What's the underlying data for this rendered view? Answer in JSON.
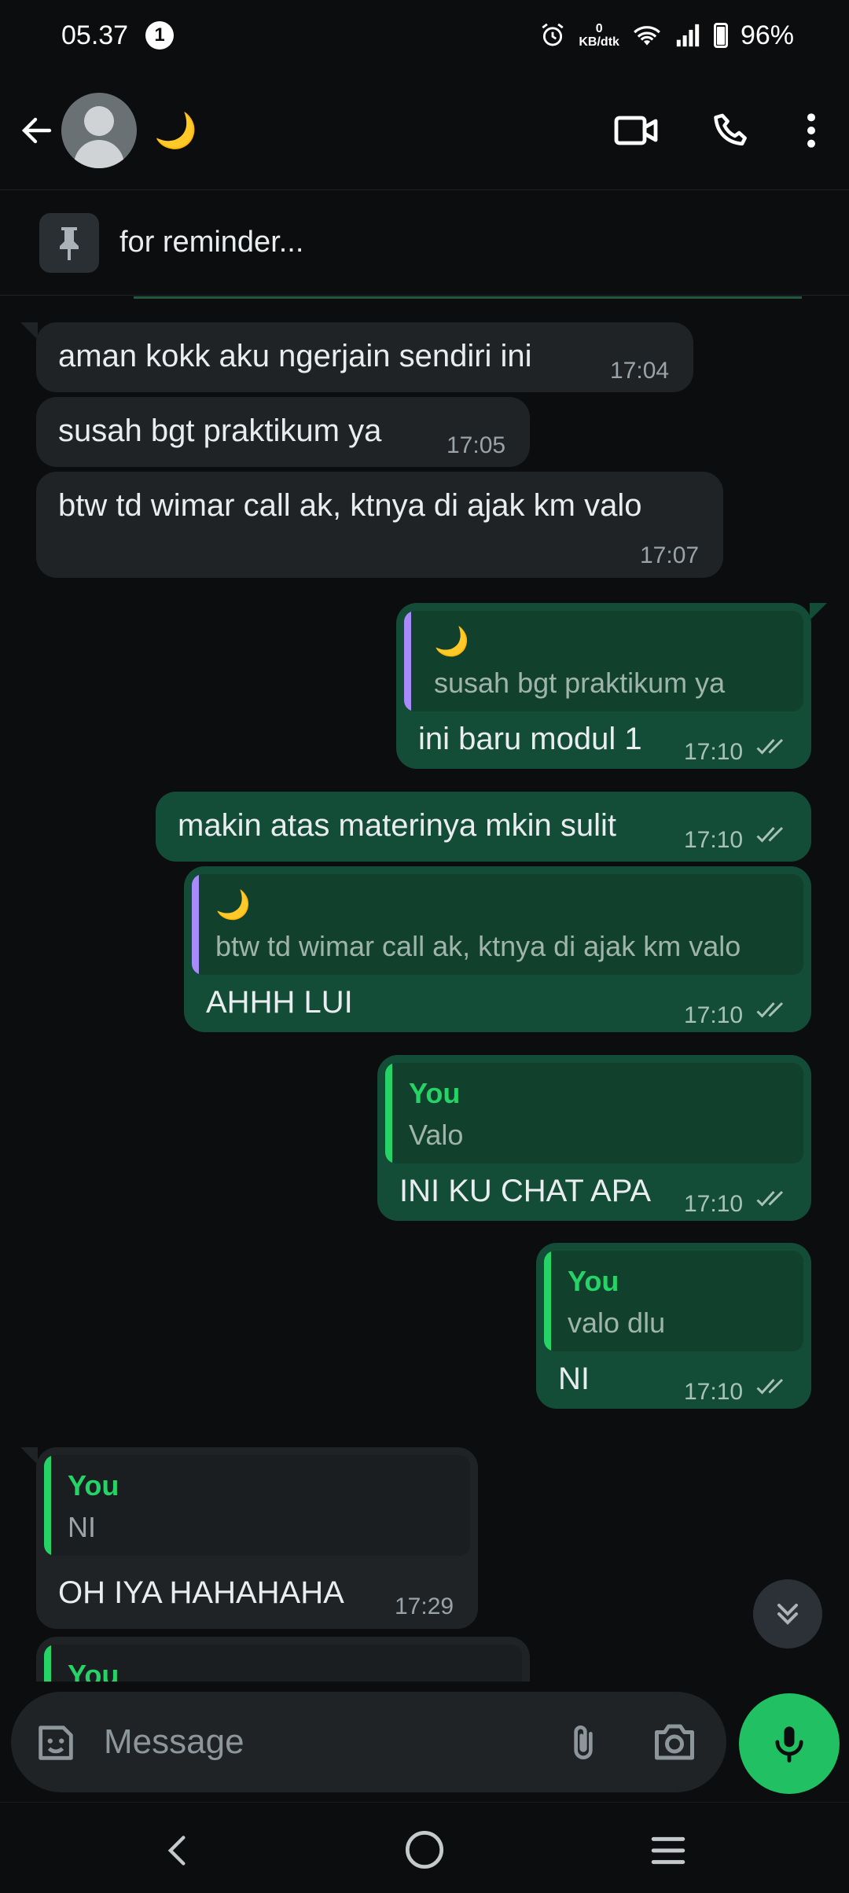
{
  "status_bar": {
    "time": "05.37",
    "notification_count": "1",
    "network_speed_value": "0",
    "network_speed_unit": "KB/dtk",
    "battery": "96%"
  },
  "header": {
    "contact_name": "🌙",
    "icons": [
      "back-arrow-icon",
      "video-call-icon",
      "phone-icon",
      "more-vert-icon"
    ]
  },
  "pinned": {
    "text": "for reminder..."
  },
  "messages": [
    {
      "dir": "in",
      "text": "aman kokk aku ngerjain sendiri ini",
      "time": "17:04"
    },
    {
      "dir": "in",
      "text": "susah bgt praktikum ya",
      "time": "17:05"
    },
    {
      "dir": "in",
      "text": "btw td wimar call ak, ktnya di ajak km valo",
      "time": "17:07"
    },
    {
      "dir": "out",
      "quote_author": "🌙",
      "quote_text": "susah bgt praktikum ya",
      "text": "ini baru modul 1",
      "time": "17:10"
    },
    {
      "dir": "out",
      "text": "makin atas materinya mkin sulit",
      "time": "17:10"
    },
    {
      "dir": "out",
      "quote_author": "🌙",
      "quote_text": "btw td wimar call ak, ktnya di ajak km valo",
      "text": "AHHH LUI",
      "time": "17:10"
    },
    {
      "dir": "out",
      "quote_author": "You",
      "quote_text": "Valo",
      "text": "INI KU CHAT APA",
      "time": "17:10"
    },
    {
      "dir": "out",
      "quote_author": "You",
      "quote_text": "valo dlu",
      "text": "NI",
      "time": "17:10"
    },
    {
      "dir": "in",
      "quote_author": "You",
      "quote_text": "NI",
      "text": "OH IYA HAHAHAHA",
      "time": "17:29"
    },
    {
      "dir": "in",
      "quote_author": "You"
    }
  ],
  "composer": {
    "placeholder": "Message",
    "icons": [
      "sticker-icon",
      "attach-icon",
      "camera-icon",
      "mic-icon"
    ]
  },
  "colors": {
    "background": "#0b0d0e",
    "incoming_bubble": "#1f2326",
    "outgoing_bubble": "#144d37",
    "accent_green": "#21c063",
    "quote_bar_purple": "#a78bfa",
    "quote_bar_green": "#25d366"
  }
}
